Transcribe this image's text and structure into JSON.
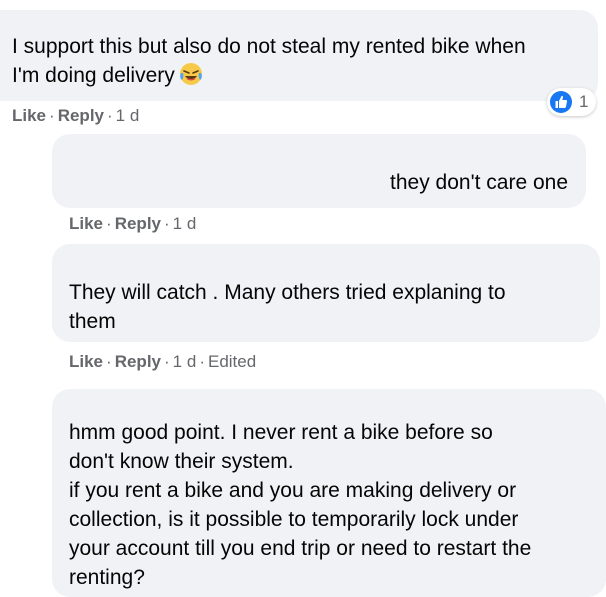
{
  "comments": [
    {
      "text": "I support this but also do not steal my rented bike when\nI'm doing delivery",
      "emoji": "laughing-crying-face-icon",
      "actions": {
        "like": "Like",
        "reply": "Reply",
        "time": "1 d"
      },
      "reactions": {
        "icon": "like-icon",
        "count": "1"
      }
    },
    {
      "text": "they don't care one",
      "actions": {
        "like": "Like",
        "reply": "Reply",
        "time": "1 d"
      }
    },
    {
      "text": "They will catch . Many others tried explaning to\nthem",
      "actions": {
        "like": "Like",
        "reply": "Reply",
        "time": "1 d",
        "edited": "Edited"
      }
    },
    {
      "text": "hmm good point. I never rent a bike before so\ndon't know their system.\nif you rent a bike and you are making delivery or\ncollection, is it possible to temporarily lock under\nyour account till you end trip or need to restart the\nrenting?"
    }
  ],
  "colors": {
    "bubble": "#f0f2f5",
    "meta_text": "#65676b",
    "like_blue": "#1877f2"
  }
}
